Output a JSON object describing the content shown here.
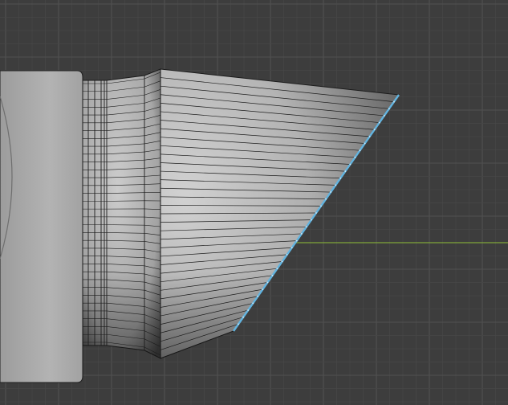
{
  "viewport": {
    "background": "#3d3d3d",
    "grid_minor_color": "#474747",
    "grid_major_color": "#515151",
    "x_axis_color": "#7fa63a",
    "selected_edge_color": "#62b4e0"
  },
  "model": {
    "surface_color": "#b9b9b9",
    "wire_color": "#1c1c1c"
  }
}
